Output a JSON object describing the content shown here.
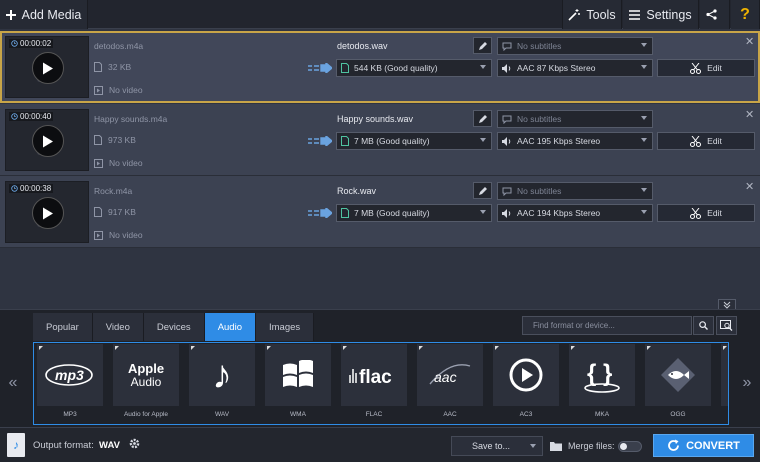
{
  "toolbar": {
    "add_media": "Add Media",
    "tools": "Tools",
    "settings": "Settings",
    "help": "?"
  },
  "files": [
    {
      "duration": "00:00:02",
      "source_name": "detodos.m4a",
      "source_size": "32 KB",
      "video": "No video",
      "output_name": "detodos.wav",
      "output_size": "544 KB (Good quality)",
      "subtitles": "No subtitles",
      "audio": "AAC 87 Kbps Stereo",
      "edit": "Edit"
    },
    {
      "duration": "00:00:40",
      "source_name": "Happy sounds.m4a",
      "source_size": "973 KB",
      "video": "No video",
      "output_name": "Happy sounds.wav",
      "output_size": "7 MB (Good quality)",
      "subtitles": "No subtitles",
      "audio": "AAC 195 Kbps Stereo",
      "edit": "Edit"
    },
    {
      "duration": "00:00:38",
      "source_name": "Rock.m4a",
      "source_size": "917 KB",
      "video": "No video",
      "output_name": "Rock.wav",
      "output_size": "7 MB (Good quality)",
      "subtitles": "No subtitles",
      "audio": "AAC 194 Kbps Stereo",
      "edit": "Edit"
    }
  ],
  "tabs": [
    "Popular",
    "Video",
    "Devices",
    "Audio",
    "Images"
  ],
  "active_tab": "Audio",
  "search": {
    "placeholder": "Find format or device..."
  },
  "formats": [
    {
      "label": "MP3",
      "logo": "mp3"
    },
    {
      "label": "Audio for Apple",
      "logo_line1": "Apple",
      "logo_line2": "Audio"
    },
    {
      "label": "WAV",
      "logo": "♪"
    },
    {
      "label": "WMA",
      "logo": "windows"
    },
    {
      "label": "FLAC",
      "logo": "flac"
    },
    {
      "label": "AAC",
      "logo": "aac"
    },
    {
      "label": "AC3",
      "logo": "play"
    },
    {
      "label": "MKA",
      "logo": "{ }"
    },
    {
      "label": "OGG",
      "logo": "fish"
    }
  ],
  "bottom": {
    "output_format_label": "Output format:",
    "output_format_value": "WAV",
    "save_to": "Save to...",
    "merge_files": "Merge files:",
    "convert": "CONVERT"
  },
  "colors": {
    "accent": "#2f8ce6",
    "selection": "#c8a548",
    "help": "#f0b400"
  }
}
